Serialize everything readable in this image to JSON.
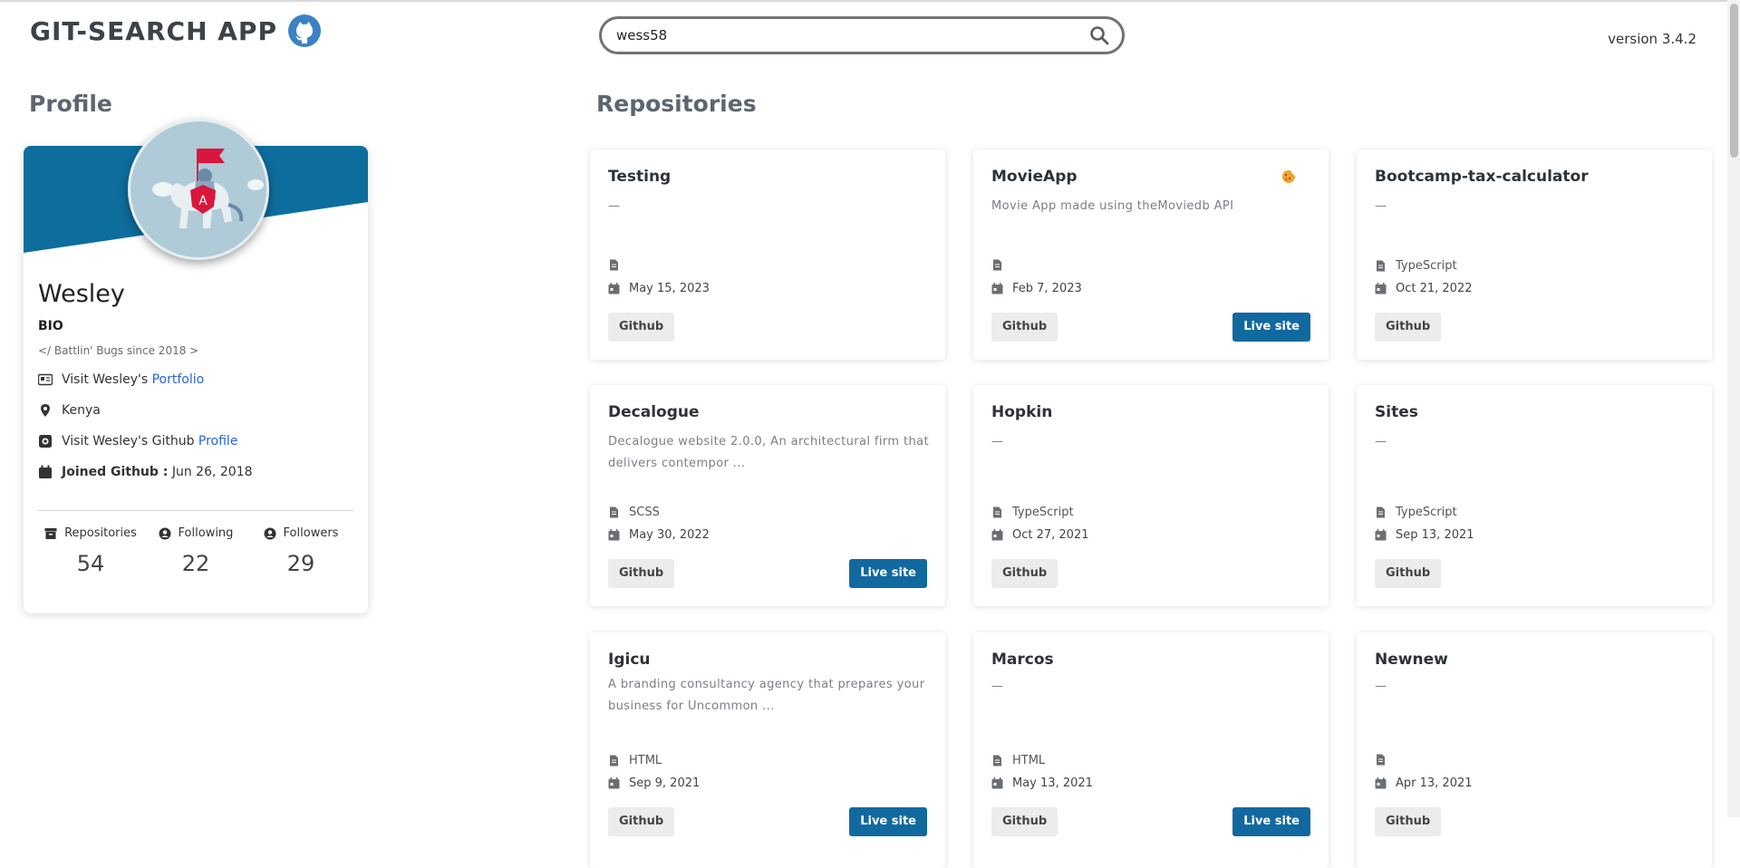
{
  "header": {
    "title": "GIT-SEARCH APP",
    "search": {
      "value": "wess58",
      "placeholder": ""
    },
    "version": "version 3.4.2"
  },
  "profile": {
    "section_title": "Profile",
    "name": "Wesley",
    "bio_label": "BIO",
    "bio": "</ Battlin' Bugs since 2018 >",
    "portfolio_prefix": "Visit Wesley's",
    "portfolio_link": "Portfolio",
    "location": "Kenya",
    "github_prefix": "Visit Wesley's Github",
    "github_link": "Profile",
    "joined_label": "Joined Github :",
    "joined_date": "Jun 26, 2018",
    "stats": {
      "repositories_label": "Repositories",
      "repositories_value": "54",
      "following_label": "Following",
      "following_value": "22",
      "followers_label": "Followers",
      "followers_value": "29"
    },
    "colors": {
      "banner": "#0d6d9d",
      "avatar_bg": "#aecbd7",
      "flag": "#d9163b"
    }
  },
  "repositories": {
    "section_title": "Repositories",
    "github_label": "Github",
    "live_label": "Live site",
    "items": [
      {
        "name": "Testing",
        "description": "—",
        "language": "",
        "date": "May 15, 2023",
        "live": false,
        "badge_icon": ""
      },
      {
        "name": "MovieApp",
        "description": "Movie App made using theMoviedb API",
        "language": "",
        "date": "Feb 7, 2023",
        "live": true,
        "badge_icon": "cookie-icon"
      },
      {
        "name": "Bootcamp-tax-calculator",
        "description": "—",
        "language": "TypeScript",
        "date": "Oct 21, 2022",
        "live": false,
        "badge_icon": ""
      },
      {
        "name": "Decalogue",
        "description": "Decalogue website 2.0.0, An architectural firm that delivers contempor ...",
        "language": "SCSS",
        "date": "May 30, 2022",
        "live": true,
        "badge_icon": ""
      },
      {
        "name": "Hopkin",
        "description": "—",
        "language": "TypeScript",
        "date": "Oct 27, 2021",
        "live": false,
        "badge_icon": ""
      },
      {
        "name": "Sites",
        "description": "—",
        "language": "TypeScript",
        "date": "Sep 13, 2021",
        "live": false,
        "badge_icon": ""
      },
      {
        "name": "Igicu",
        "description": "A branding consultancy agency that prepares your business for Uncommon ...",
        "language": "HTML",
        "date": "Sep 9, 2021",
        "live": true,
        "badge_icon": ""
      },
      {
        "name": "Marcos",
        "description": "—",
        "language": "HTML",
        "date": "May 13, 2021",
        "live": true,
        "badge_icon": ""
      },
      {
        "name": "Newnew",
        "description": "—",
        "language": "",
        "date": "Apr 13, 2021",
        "live": false,
        "badge_icon": ""
      }
    ],
    "colors": {
      "live_button": "#1169a0",
      "github_button": "#ececec",
      "cookie": "#f0a030"
    }
  }
}
